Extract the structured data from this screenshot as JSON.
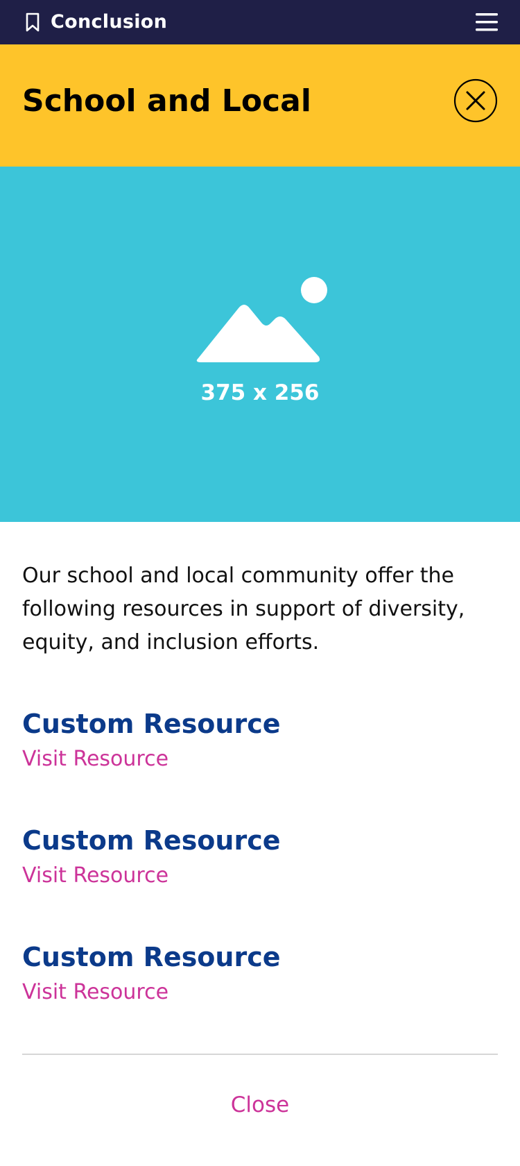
{
  "topbar": {
    "title": "Conclusion",
    "background": "#1f1f47",
    "bookmark_icon": "bookmark-icon",
    "menu_icon": "hamburger-menu-icon"
  },
  "header": {
    "title": "School and Local",
    "background": "#fec42a",
    "close_icon": "close-icon"
  },
  "hero": {
    "placeholder_label": "375 x 256",
    "background": "#3cc5d9",
    "icon": "image-placeholder-icon"
  },
  "intro": "Our school and local community offer the following resources in support of diversity, equity, and inclusion efforts.",
  "resources": [
    {
      "title": "Custom Resource",
      "link": "Visit Resource"
    },
    {
      "title": "Custom Resource",
      "link": "Visit Resource"
    },
    {
      "title": "Custom Resource",
      "link": "Visit Resource"
    }
  ],
  "footer": {
    "close_label": "Close"
  },
  "colors": {
    "resource_title": "#0b3a8a",
    "link": "#cc3399"
  }
}
